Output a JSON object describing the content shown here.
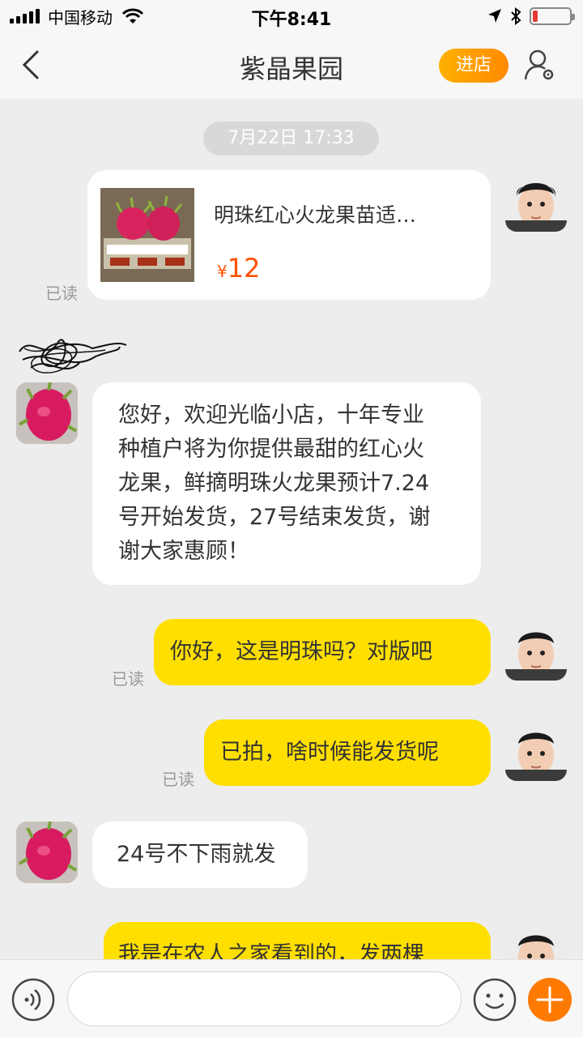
{
  "status_bar": {
    "carrier": "中国移动",
    "time": "下午8:41"
  },
  "nav": {
    "title": "紫晶果园",
    "shop_button": "进店"
  },
  "chat": {
    "timestamp": "7月22日 17:33",
    "product": {
      "title": "明珠红心火龙果苗适…",
      "currency": "¥",
      "price": "12"
    },
    "read_label": "已读",
    "messages": [
      {
        "sender": "shop",
        "text": [
          "您好，欢迎光临小店，十年专业",
          "种植户将为你提供最甜的红心火",
          "龙果，鲜摘明珠火龙果预计7.24",
          "号开始发货，27号结束发货，谢",
          "谢大家惠顾！"
        ]
      },
      {
        "sender": "me",
        "text": "你好，这是明珠吗？对版吧",
        "read": true
      },
      {
        "sender": "me",
        "text": "已拍，啥时候能发货呢",
        "read": true
      },
      {
        "sender": "shop",
        "text": "24号不下雨就发"
      },
      {
        "sender": "me",
        "text": "我是在农人之家看到的，发两棵"
      }
    ]
  },
  "colors": {
    "accent_orange": "#ff8a00",
    "my_bubble": "#ffdf00",
    "price": "#ff5000"
  }
}
